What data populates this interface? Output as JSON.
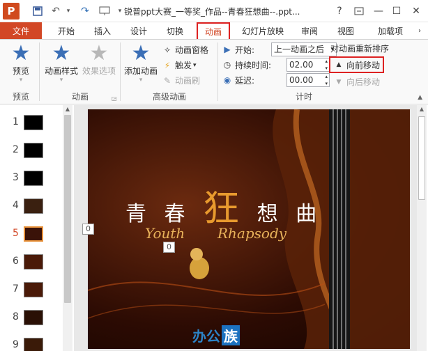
{
  "titlebar": {
    "logo": "P",
    "doc_title": "锐普ppt大赛_一等奖_作品--青春狂想曲--.ppt...",
    "help": "?",
    "minimize": "—",
    "maximize": "☐",
    "close": "✕"
  },
  "tabs": [
    {
      "label": "文件"
    },
    {
      "label": "开始"
    },
    {
      "label": "插入"
    },
    {
      "label": "设计"
    },
    {
      "label": "切换"
    },
    {
      "label": "动画",
      "active": true
    },
    {
      "label": "幻灯片放映"
    },
    {
      "label": "审阅"
    },
    {
      "label": "视图"
    },
    {
      "label": "加载项"
    }
  ],
  "ribbon": {
    "preview": {
      "button": "预览",
      "group": "预览"
    },
    "animation": {
      "style_button": "动画样式",
      "effects_button": "效果选项",
      "group": "动画"
    },
    "advanced": {
      "add_button": "添加动画",
      "pane": "动画窗格",
      "trigger": "触发",
      "painter": "动画刷",
      "group": "高级动画"
    },
    "timing": {
      "start_label": "开始:",
      "start_value": "上一动画之后",
      "duration_label": "持续时间:",
      "duration_value": "02.00",
      "delay_label": "延迟:",
      "delay_value": "00.00",
      "reorder_title": "对动画重新排序",
      "move_earlier": "向前移动",
      "move_later": "向后移动",
      "group": "计时"
    }
  },
  "thumbnails": [
    {
      "num": "1"
    },
    {
      "num": "2"
    },
    {
      "num": "3"
    },
    {
      "num": "4"
    },
    {
      "num": "5",
      "selected": true
    },
    {
      "num": "6"
    },
    {
      "num": "7"
    },
    {
      "num": "8"
    },
    {
      "num": "9"
    }
  ],
  "slide": {
    "title_part1": "青 春",
    "title_big": "狂",
    "title_part2": "想 曲",
    "subtitle_left": "Youth",
    "subtitle_right": "Rhapsody",
    "tag_left": "0",
    "tag_center": "0",
    "watermark_part1": "办公",
    "watermark_part2": "族"
  }
}
